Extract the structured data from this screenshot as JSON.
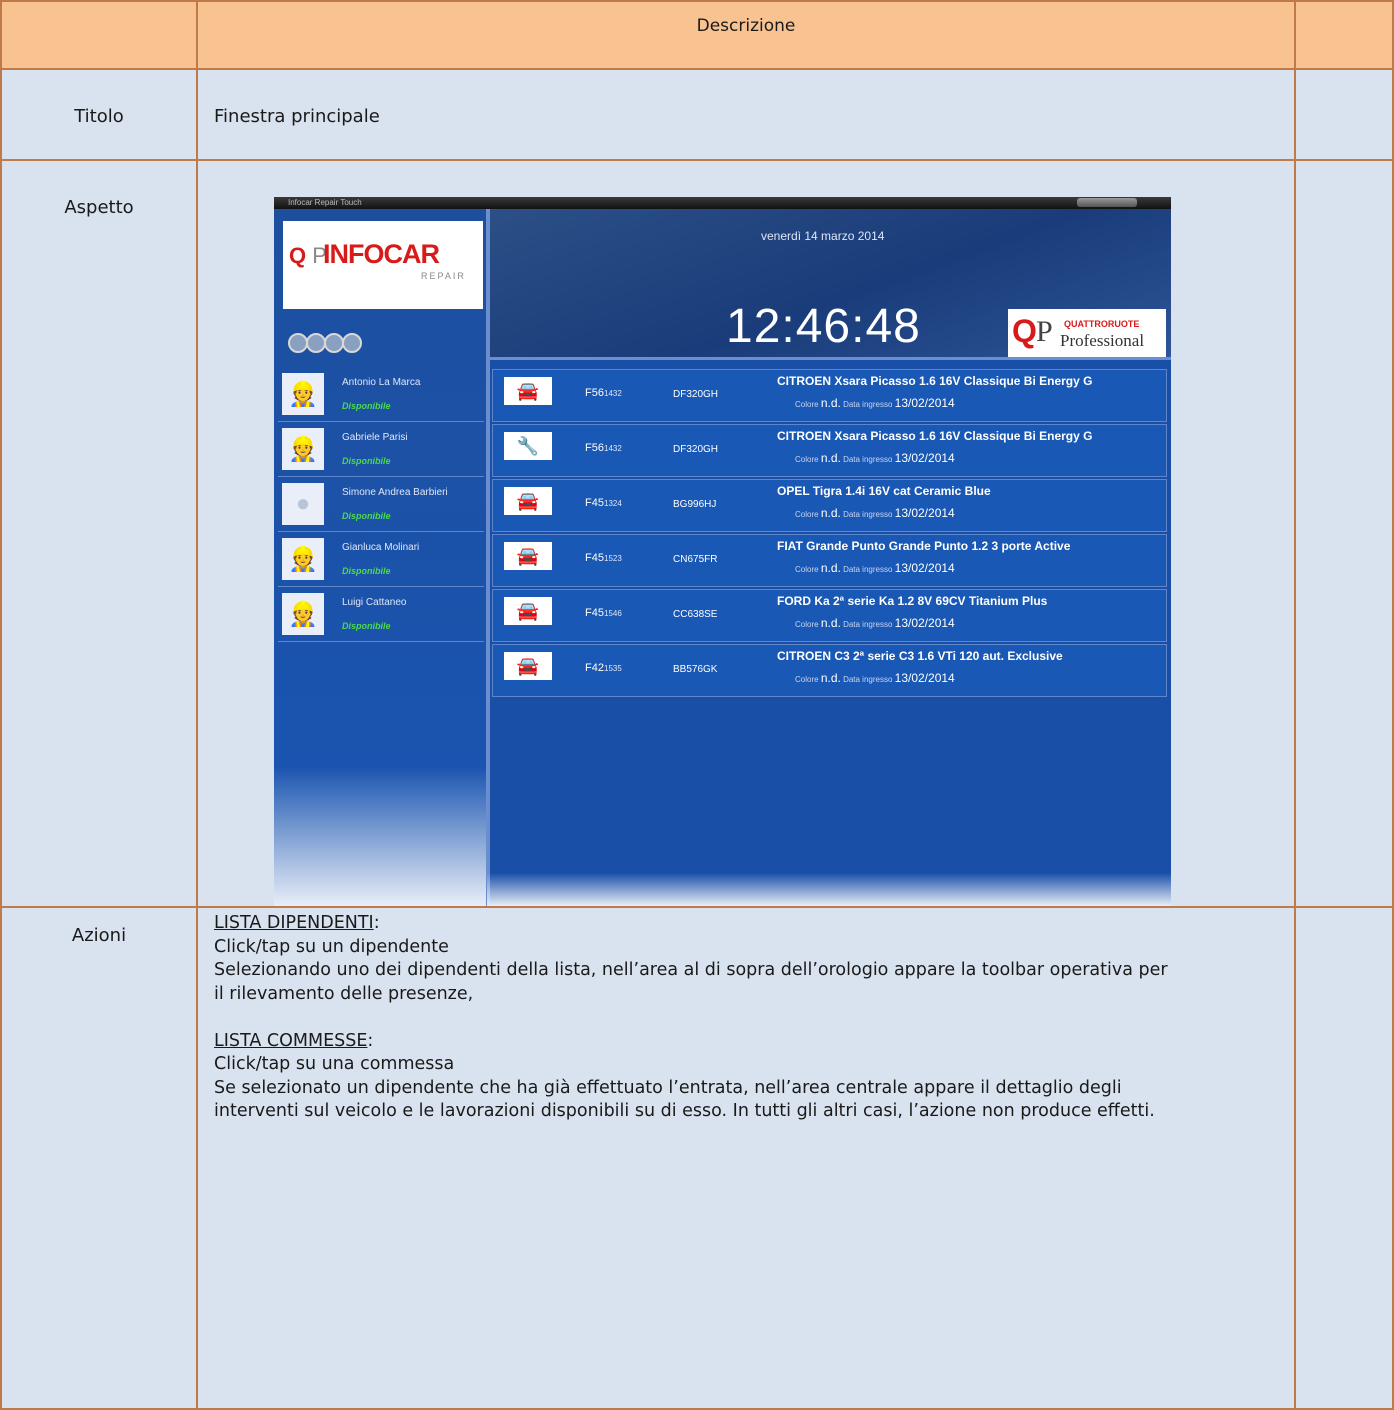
{
  "header": {
    "title": "Descrizione"
  },
  "rows": {
    "title": {
      "label": "Titolo",
      "value": "Finestra principale"
    },
    "look": {
      "label": "Aspetto"
    },
    "actions": {
      "label": "Azioni",
      "employees_heading": "LISTA DIPENDENTI",
      "employees_action": "Click/tap su un dipendente",
      "employees_desc_1": "Selezionando uno dei dipendenti della lista, nell’area al di sopra dell’orologio appare la toolbar operativa per",
      "employees_desc_2": "il rilevamento delle presenze,",
      "orders_heading": "LISTA COMMESSE",
      "orders_action": "Click/tap su una commessa",
      "orders_desc_1": "Se selezionato un dipendente che ha già effettuato l’entrata, nell’area centrale appare il dettaglio degli",
      "orders_desc_2": "interventi sul veicolo e le lavorazioni disponibili su di esso. In tutti gli altri casi, l’azione non produce effetti."
    }
  },
  "app": {
    "window_title": "Infocar Repair Touch",
    "logo": {
      "brand": "INFOCAR",
      "sub": "REPAIR"
    },
    "date": "venerdì 14 marzo 2014",
    "time": "12:46:48",
    "brand2": {
      "line1": "QUATTRORUOTE",
      "line2": "Professional"
    },
    "employees": [
      {
        "name": "Antonio La Marca",
        "status": "Disponibile",
        "avatar": "worker-icon"
      },
      {
        "name": "Gabriele Parisi",
        "status": "Disponibile",
        "avatar": "worker-icon"
      },
      {
        "name": "Simone Andrea Barbieri",
        "status": "Disponibile",
        "avatar": "user-silhouette-icon"
      },
      {
        "name": "Gianluca Molinari",
        "status": "Disponibile",
        "avatar": "worker-icon"
      },
      {
        "name": "Luigi Cattaneo",
        "status": "Disponibile",
        "avatar": "worker-icon"
      }
    ],
    "orders_labels": {
      "color": "Colore",
      "date": "Data ingresso"
    },
    "orders": [
      {
        "icon": "car-icon",
        "code": "F56",
        "num": "1432",
        "plate": "DF320GH",
        "title": "CITROEN Xsara Picasso 1.6 16V Classique Bi Energy G",
        "color": "n.d.",
        "date": "13/02/2014"
      },
      {
        "icon": "tools-icon",
        "code": "F56",
        "num": "1432",
        "plate": "DF320GH",
        "title": "CITROEN Xsara Picasso 1.6 16V Classique Bi Energy G",
        "color": "n.d.",
        "date": "13/02/2014"
      },
      {
        "icon": "car-icon",
        "code": "F45",
        "num": "1324",
        "plate": "BG996HJ",
        "title": "OPEL Tigra 1.4i 16V cat Ceramic Blue",
        "color": "n.d.",
        "date": "13/02/2014"
      },
      {
        "icon": "car-icon",
        "code": "F45",
        "num": "1523",
        "plate": "CN675FR",
        "title": "FIAT Grande Punto Grande Punto 1.2 3 porte Active",
        "color": "n.d.",
        "date": "13/02/2014"
      },
      {
        "icon": "car-icon",
        "code": "F45",
        "num": "1546",
        "plate": "CC638SE",
        "title": "FORD Ka 2ª serie Ka 1.2 8V 69CV Titanium Plus",
        "color": "n.d.",
        "date": "13/02/2014"
      },
      {
        "icon": "car-icon",
        "code": "F42",
        "num": "1535",
        "plate": "BB576GK",
        "title": "CITROEN C3 2ª serie C3 1.6 VTi 120 aut. Exclusive",
        "color": "n.d.",
        "date": "13/02/2014"
      }
    ]
  }
}
